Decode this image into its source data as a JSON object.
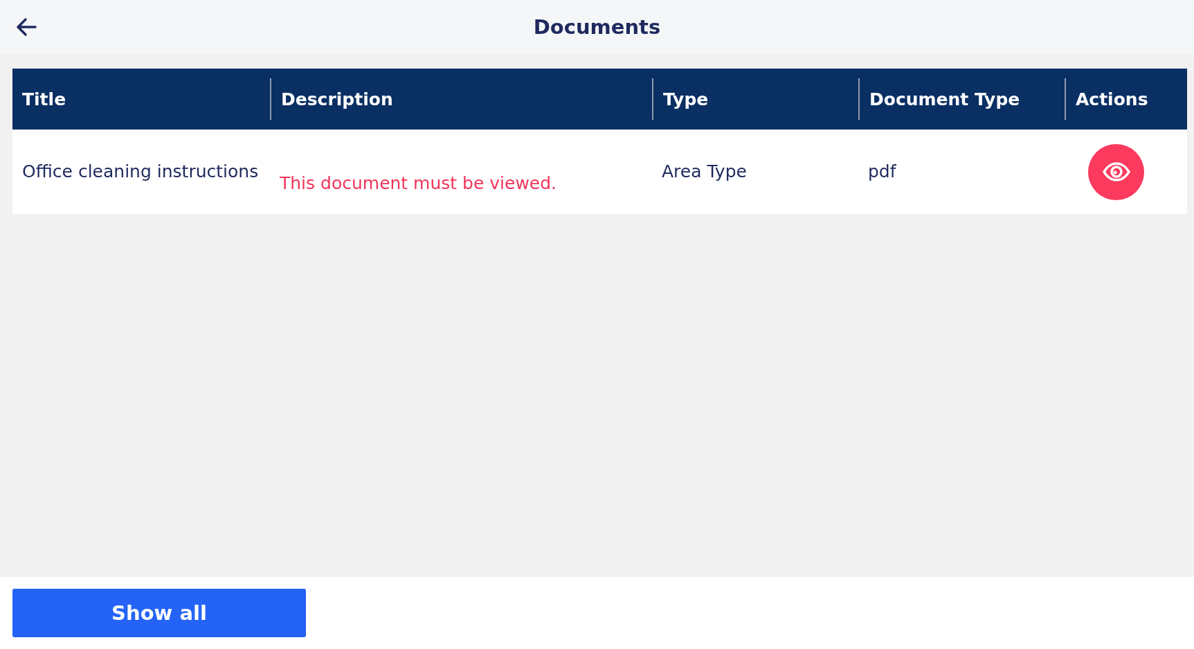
{
  "header": {
    "title": "Documents"
  },
  "table": {
    "columns": [
      "Title",
      "Description",
      "Type",
      "Document Type",
      "Actions"
    ],
    "rows": [
      {
        "title": "Office cleaning instructions",
        "description": {
          "text": "This document must be viewed.",
          "kind": "warning"
        },
        "type": "Area Type",
        "document_type": "pdf"
      }
    ]
  },
  "footer": {
    "button": "Show all"
  }
}
